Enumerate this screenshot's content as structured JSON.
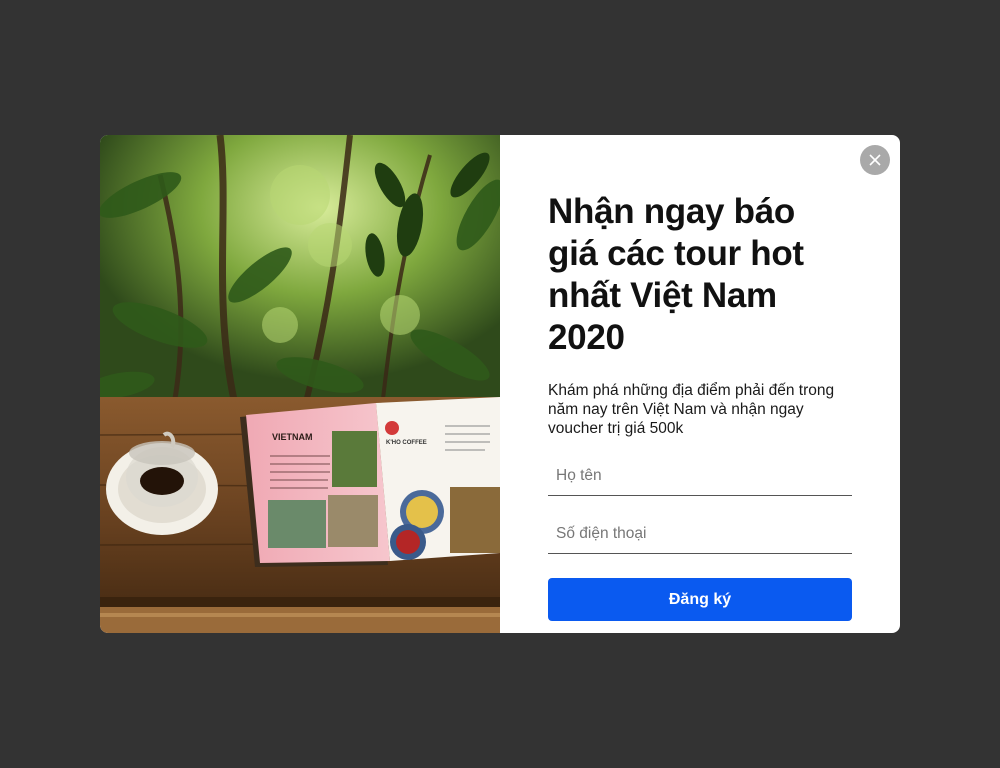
{
  "popup": {
    "close_icon": "close-icon",
    "headline": "Nhận ngay báo giá các tour hot nhất Việt Nam 2020",
    "subtext": "Khám phá những địa điểm phải đến trong năm nay trên Việt Nam và nhận ngay voucher trị giá 500k",
    "name_placeholder": "Họ tên",
    "phone_placeholder": "Số điện thoại",
    "submit_label": "Đăng ký",
    "accent_color": "#0a5af0"
  },
  "photo": {
    "book_title_left": "VIETNAM",
    "book_title_right": "K'HO COFFEE"
  }
}
